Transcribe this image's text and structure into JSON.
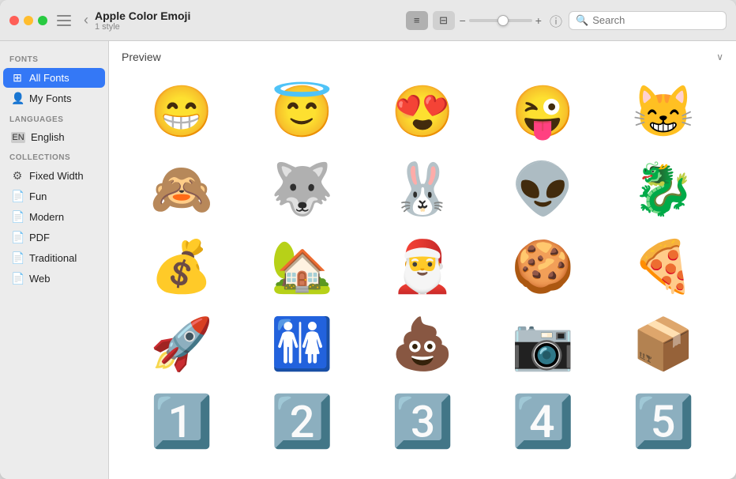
{
  "window": {
    "title": "Apple Color Emoji",
    "subtitle": "1 style"
  },
  "titlebar": {
    "back_label": "‹",
    "list_view_icon": "≡",
    "grid_view_icon": "⊟",
    "size_minus": "−",
    "size_plus": "+",
    "info_icon": "ⓘ",
    "search_placeholder": "Search"
  },
  "sidebar": {
    "fonts_label": "Fonts",
    "all_fonts_label": "All Fonts",
    "my_fonts_label": "My Fonts",
    "languages_label": "Languages",
    "english_label": "English",
    "collections_label": "Collections",
    "collections_items": [
      {
        "label": "Fixed Width",
        "icon": "⚙"
      },
      {
        "label": "Fun",
        "icon": "📄"
      },
      {
        "label": "Modern",
        "icon": "📄"
      },
      {
        "label": "PDF",
        "icon": "📄"
      },
      {
        "label": "Traditional",
        "icon": "📄"
      },
      {
        "label": "Web",
        "icon": "📄"
      }
    ]
  },
  "preview": {
    "label": "Preview",
    "emojis": [
      "😁",
      "😇",
      "😍",
      "😜",
      "😸",
      "🙈",
      "🐺",
      "🐰",
      "👽",
      "🐉",
      "💰",
      "🏡",
      "🎅",
      "🍪",
      "🍕",
      "🚀",
      "🚻",
      "💩",
      "📷",
      "📦",
      "1️⃣",
      "2️⃣",
      "3️⃣",
      "4️⃣",
      "5️⃣"
    ]
  }
}
